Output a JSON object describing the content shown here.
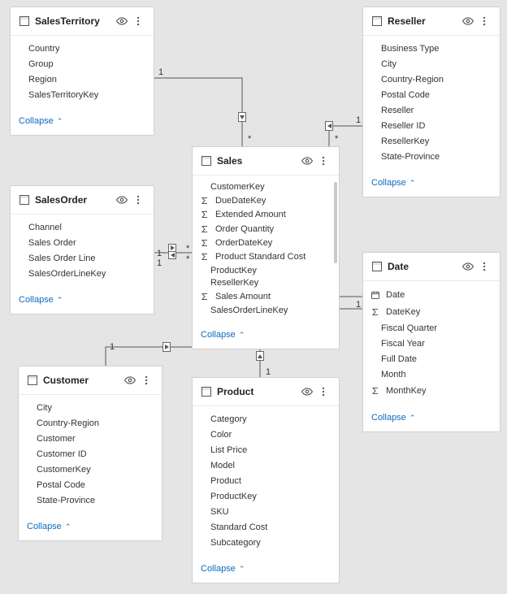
{
  "ui": {
    "collapse_label": "Collapse"
  },
  "tables": {
    "salesTerritory": {
      "name": "SalesTerritory",
      "fields": [
        {
          "label": "Country",
          "icon": null
        },
        {
          "label": "Group",
          "icon": null
        },
        {
          "label": "Region",
          "icon": null
        },
        {
          "label": "SalesTerritoryKey",
          "icon": null
        }
      ]
    },
    "reseller": {
      "name": "Reseller",
      "fields": [
        {
          "label": "Business Type",
          "icon": null
        },
        {
          "label": "City",
          "icon": null
        },
        {
          "label": "Country-Region",
          "icon": null
        },
        {
          "label": "Postal Code",
          "icon": null
        },
        {
          "label": "Reseller",
          "icon": null
        },
        {
          "label": "Reseller ID",
          "icon": null
        },
        {
          "label": "ResellerKey",
          "icon": null
        },
        {
          "label": "State-Province",
          "icon": null
        }
      ]
    },
    "sales": {
      "name": "Sales",
      "fields": [
        {
          "label": "CustomerKey",
          "icon": null
        },
        {
          "label": "DueDateKey",
          "icon": "sigma"
        },
        {
          "label": "Extended Amount",
          "icon": "sigma"
        },
        {
          "label": "Order Quantity",
          "icon": "sigma"
        },
        {
          "label": "OrderDateKey",
          "icon": "sigma"
        },
        {
          "label": "Product Standard Cost",
          "icon": "sigma"
        },
        {
          "label": "ProductKey",
          "icon": null
        },
        {
          "label": "ResellerKey",
          "icon": null
        },
        {
          "label": "Sales Amount",
          "icon": "sigma"
        },
        {
          "label": "SalesOrderLineKey",
          "icon": null
        }
      ]
    },
    "salesOrder": {
      "name": "SalesOrder",
      "fields": [
        {
          "label": "Channel",
          "icon": null
        },
        {
          "label": "Sales Order",
          "icon": null
        },
        {
          "label": "Sales Order Line",
          "icon": null
        },
        {
          "label": "SalesOrderLineKey",
          "icon": null
        }
      ]
    },
    "date": {
      "name": "Date",
      "fields": [
        {
          "label": "Date",
          "icon": "calendar"
        },
        {
          "label": "DateKey",
          "icon": "sigma"
        },
        {
          "label": "Fiscal Quarter",
          "icon": null
        },
        {
          "label": "Fiscal Year",
          "icon": null
        },
        {
          "label": "Full Date",
          "icon": null
        },
        {
          "label": "Month",
          "icon": null
        },
        {
          "label": "MonthKey",
          "icon": "sigma"
        }
      ]
    },
    "customer": {
      "name": "Customer",
      "fields": [
        {
          "label": "City",
          "icon": null
        },
        {
          "label": "Country-Region",
          "icon": null
        },
        {
          "label": "Customer",
          "icon": null
        },
        {
          "label": "Customer ID",
          "icon": null
        },
        {
          "label": "CustomerKey",
          "icon": null
        },
        {
          "label": "Postal Code",
          "icon": null
        },
        {
          "label": "State-Province",
          "icon": null
        }
      ]
    },
    "product": {
      "name": "Product",
      "fields": [
        {
          "label": "Category",
          "icon": null
        },
        {
          "label": "Color",
          "icon": null
        },
        {
          "label": "List Price",
          "icon": null
        },
        {
          "label": "Model",
          "icon": null
        },
        {
          "label": "Product",
          "icon": null
        },
        {
          "label": "ProductKey",
          "icon": null
        },
        {
          "label": "SKU",
          "icon": null
        },
        {
          "label": "Standard Cost",
          "icon": null
        },
        {
          "label": "Subcategory",
          "icon": null
        }
      ]
    }
  },
  "relationships": [
    {
      "from": "salesTerritory",
      "to": "sales",
      "fromCard": "1",
      "toCard": "*"
    },
    {
      "from": "reseller",
      "to": "sales",
      "fromCard": "1",
      "toCard": "*"
    },
    {
      "from": "salesOrder",
      "to": "sales",
      "fromCard": "1",
      "toCard": "*",
      "bidirectional": true
    },
    {
      "from": "customer",
      "to": "sales",
      "fromCard": "1",
      "toCard": "*"
    },
    {
      "from": "product",
      "to": "sales",
      "fromCard": "1",
      "toCard": "*"
    },
    {
      "from": "date",
      "to": "sales",
      "fromCard": "1",
      "toCard": "*"
    }
  ]
}
